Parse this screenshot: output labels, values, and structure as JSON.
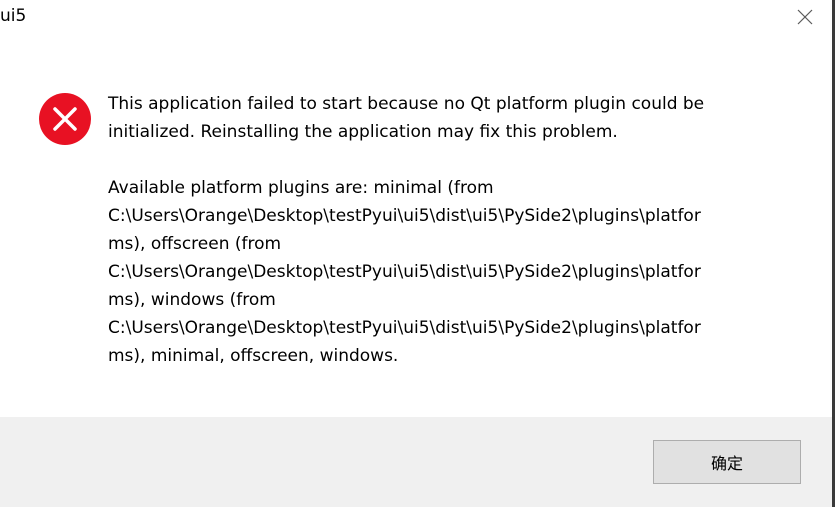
{
  "window": {
    "title": "ui5"
  },
  "dialog": {
    "message_line1": "This application failed to start because no Qt platform plugin could be initialized. Reinstalling the application may fix this problem.",
    "message_details": "Available platform plugins are: minimal (from\nC:\\Users\\Orange\\Desktop\\testPyui\\ui5\\dist\\ui5\\PySide2\\plugins\\platfor\nms), offscreen (from\nC:\\Users\\Orange\\Desktop\\testPyui\\ui5\\dist\\ui5\\PySide2\\plugins\\platfor\nms), windows (from\nC:\\Users\\Orange\\Desktop\\testPyui\\ui5\\dist\\ui5\\PySide2\\plugins\\platfor\nms), minimal, offscreen, windows.",
    "ok_label": "确定"
  },
  "icons": {
    "error": "error-x-icon",
    "close": "close-icon"
  },
  "colors": {
    "error_red": "#e81123",
    "footer_bg": "#f0f0f0",
    "button_bg": "#e1e1e1",
    "button_border": "#adadad"
  }
}
